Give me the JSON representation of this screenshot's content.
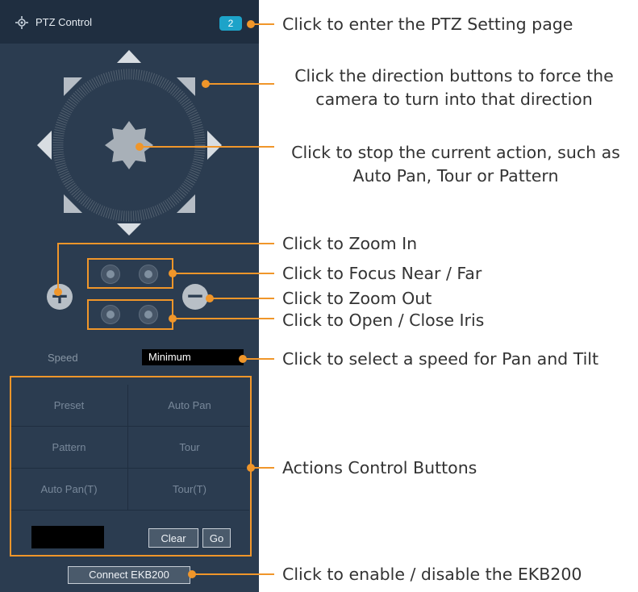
{
  "panel": {
    "title": "PTZ Control",
    "title_icon": "ptz-crosshair-icon",
    "setting_badge": "2",
    "speed_label": "Speed",
    "speed_value": "Minimum",
    "zoom_in_symbol": "+",
    "zoom_out_symbol": "−",
    "actions": [
      "Preset",
      "Auto Pan",
      "Pattern",
      "Tour",
      "Auto Pan(T)",
      "Tour(T)"
    ],
    "preset_input_value": "",
    "clear_label": "Clear",
    "go_label": "Go",
    "connect_label": "Connect EKB200"
  },
  "callouts": {
    "ptz_setting": "Click to enter the PTZ Setting page",
    "direction_1": "Click the direction buttons to force the",
    "direction_2": "camera to turn into that direction",
    "stop_1": "Click to stop the current action, such as",
    "stop_2": "Auto Pan, Tour or Pattern",
    "zoom_in": "Click to Zoom In",
    "focus": "Click to Focus Near / Far",
    "zoom_out": "Click to Zoom Out",
    "iris": "Click to Open / Close Iris",
    "speed": "Click to select a speed for Pan and Tilt",
    "actions": "Actions Control Buttons",
    "ekb": "Click to enable / disable the EKB200"
  },
  "colors": {
    "panel_bg": "#2b3c50",
    "header_bg": "#1f2e40",
    "accent_orange": "#f0962a",
    "badge_blue": "#1da3c9"
  }
}
